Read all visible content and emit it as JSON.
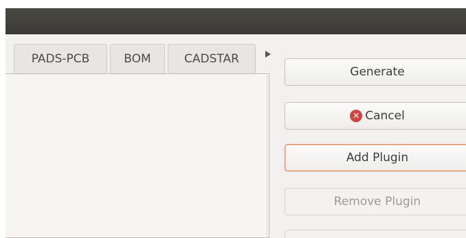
{
  "tabs": [
    {
      "label": "PADS-PCB"
    },
    {
      "label": "BOM"
    },
    {
      "label": "CADSTAR"
    }
  ],
  "tab_scroll_icon": "right-arrow-icon",
  "buttons": {
    "generate": "Generate",
    "cancel": "Cancel",
    "cancel_icon": "cancel-icon",
    "add_plugin": "Add Plugin",
    "remove_plugin": "Remove Plugin"
  },
  "colors": {
    "titlebar": "#3b3a36",
    "focus_border": "#e8865e",
    "cancel_icon": "#d8403a"
  }
}
